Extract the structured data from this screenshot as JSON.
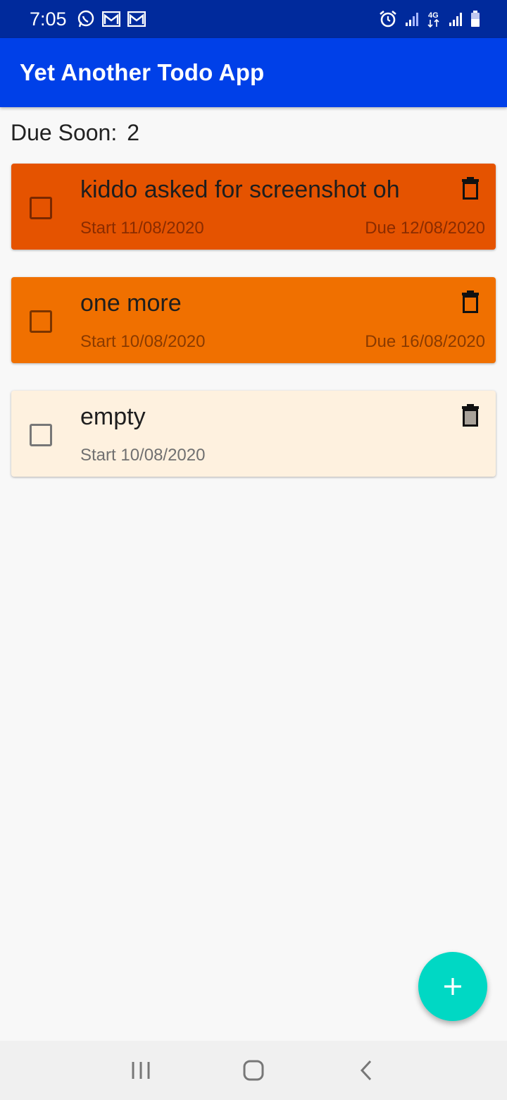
{
  "status": {
    "time": "7:05",
    "left_icons": [
      "whatsapp-icon",
      "gmail-icon",
      "gmail-icon"
    ],
    "right_icons": [
      "alarm-icon",
      "signal-icon",
      "4g-icon",
      "signal-icon",
      "battery-icon"
    ],
    "network_label": "4G"
  },
  "app_bar": {
    "title": "Yet Another Todo App",
    "color": "#0040e8"
  },
  "summary": {
    "label": "Due Soon:",
    "count": "2"
  },
  "todos": [
    {
      "title": "kiddo asked for screenshot oh",
      "start": "Start 11/08/2020",
      "due": "Due 12/08/2020",
      "color": "#e55300",
      "checked": false
    },
    {
      "title": "one more",
      "start": "Start 10/08/2020",
      "due": "Due 16/08/2020",
      "color": "#f07000",
      "checked": false
    },
    {
      "title": "empty",
      "start": "Start 10/08/2020",
      "due": "",
      "color": "#fef1df",
      "checked": false
    }
  ],
  "fab": {
    "icon": "plus-icon",
    "color": "#00d8c4"
  },
  "nav": {
    "icons": [
      "recent-apps-icon",
      "home-icon",
      "back-icon"
    ]
  }
}
